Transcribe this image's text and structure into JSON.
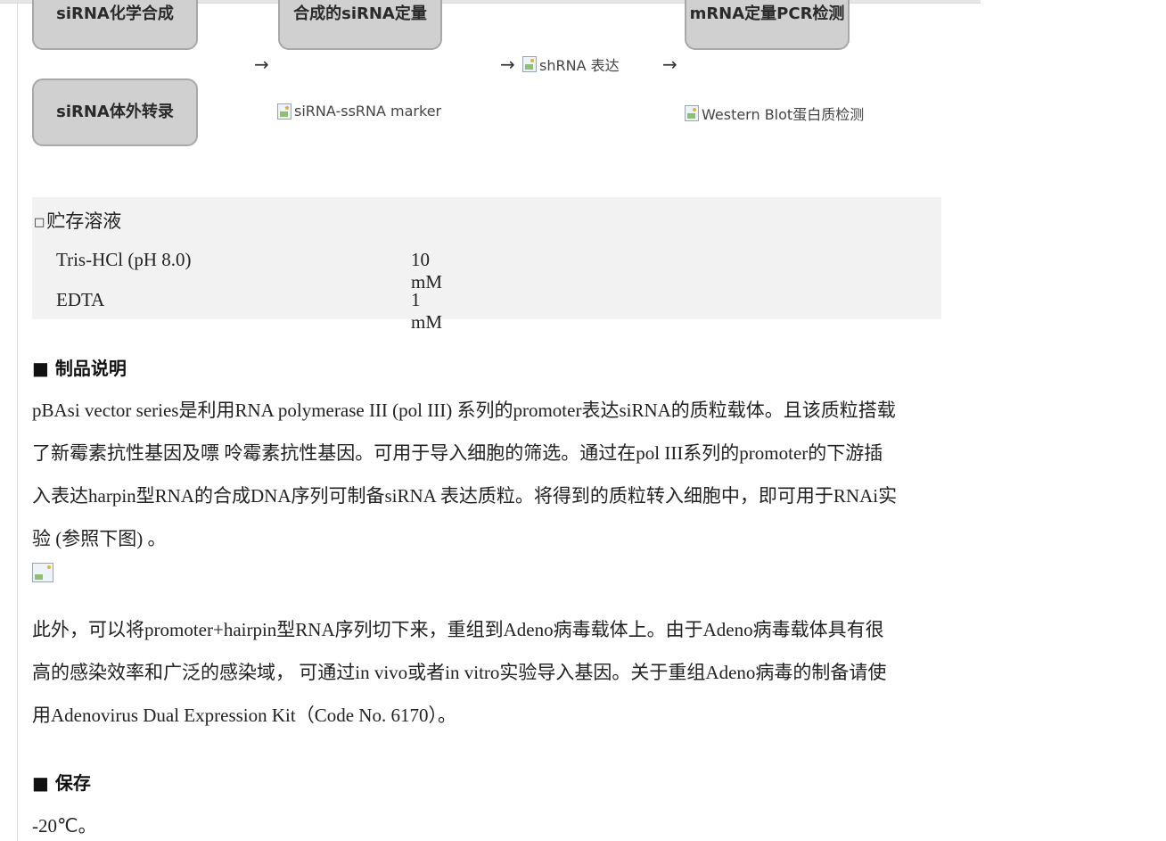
{
  "flow": {
    "box_chem_synthesis": "siRNA化学合成",
    "box_quant": "合成的siRNA定量",
    "box_pcr": "mRNA定量PCR检测",
    "box_ivt": "siRNA体外转录",
    "arrow": "→",
    "img_shrna": "shRNA 表达",
    "img_ssrna_marker": "siRNA-ssRNA marker",
    "img_western": "Western Blot蛋白质检测"
  },
  "storage": {
    "title": "贮存溶液",
    "rows": [
      {
        "name": "Tris-HCl (pH 8.0)",
        "value": "10 mM"
      },
      {
        "name": "EDTA",
        "value": "1 mM"
      }
    ]
  },
  "description": {
    "heading": "制品说明",
    "para1_lines": [
      "pBAsi vector series是利用RNA polymerase III (pol III) 系列的promoter表达siRNA的质粒载体。且该质粒搭载",
      "了新霉素抗性基因及嘌 呤霉素抗性基因。可用于导入细胞的筛选。通过在pol III系列的promoter的下游插",
      "入表达harpin型RNA的合成DNA序列可制备siRNA 表达质粒。将得到的质粒转入细胞中，即可用于RNAi实",
      "验 (参照下图) 。"
    ],
    "para2_lines": [
      "此外，可以将promoter+hairpin型RNA序列切下来，重组到Adeno病毒载体上。由于Adeno病毒载体具有很",
      "高的感染效率和广泛的感染域， 可通过in vivo或者in vitro实验导入基因。关于重组Adeno病毒的制备请使",
      "用Adenovirus Dual Expression Kit（Code No. 6170）。"
    ]
  },
  "preservation": {
    "heading": "保存",
    "value": "-20℃。"
  }
}
